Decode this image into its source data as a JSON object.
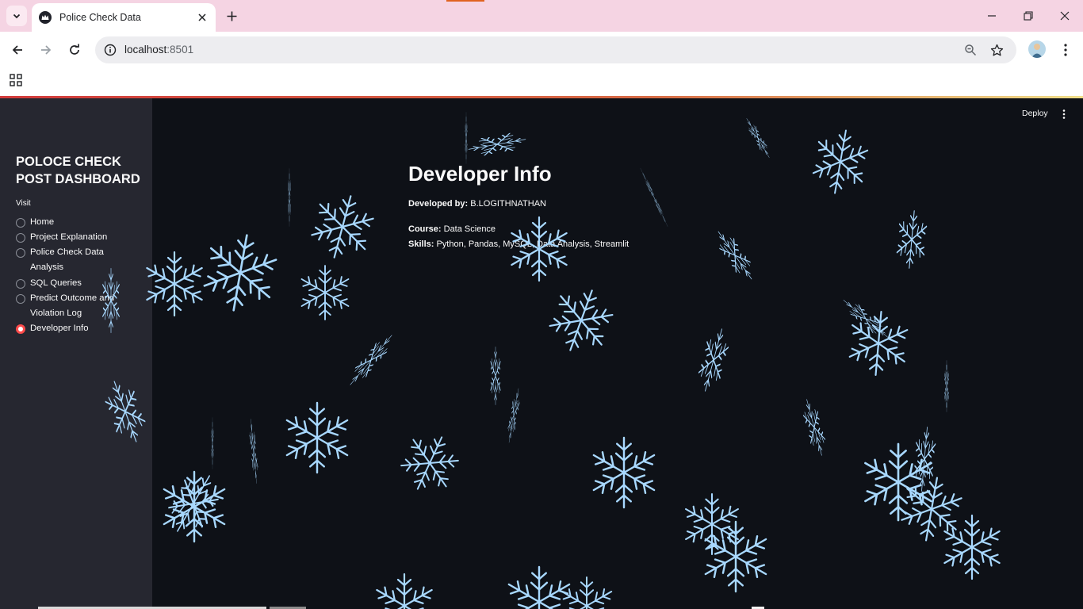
{
  "browser": {
    "tab_title": "Police Check Data",
    "url_host": "localhost",
    "url_port": ":8501"
  },
  "app": {
    "deploy_label": "Deploy"
  },
  "sidebar": {
    "title": "POLOCE CHECK POST DASHBOARD",
    "radio_label": "Visit",
    "options": [
      {
        "label": "Home"
      },
      {
        "label": "Project Explanation"
      },
      {
        "label": "Police Check Data Analysis"
      },
      {
        "label": "SQL Queries"
      },
      {
        "label": "Predict Outcome and Violation Log"
      },
      {
        "label": "Developer Info"
      }
    ],
    "selected": "Developer Info"
  },
  "main": {
    "title": "Developer Info",
    "developed_by_label": "Developed by:",
    "developed_by_value": "B.LOGITHNATHAN",
    "course_label": "Course:",
    "course_value": "Data Science",
    "skills_label": "Skills:",
    "skills_value": "Python, Pandas, MySQL, Data Analysis, Streamlit"
  },
  "colors": {
    "accent": "#ff4b4b",
    "snowflake": "#a8d8ff",
    "app_bg": "#0e1117",
    "sidebar_bg": "#262730"
  }
}
